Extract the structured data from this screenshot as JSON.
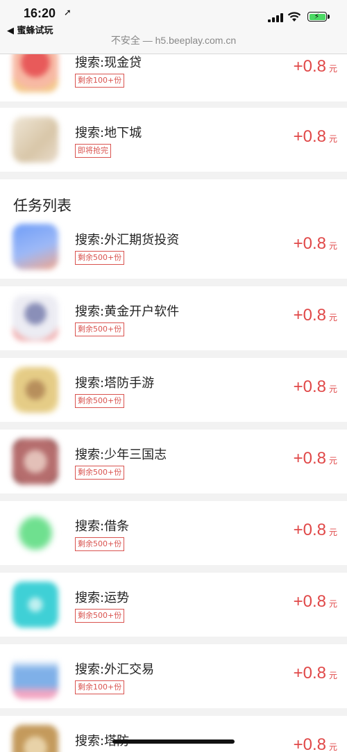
{
  "status": {
    "time": "16:20",
    "back_app": "◀ 蜜蜂试玩",
    "url": "不安全 — h5.beeplay.com.cn"
  },
  "section_title": "任务列表",
  "top_tasks": [
    {
      "title": "搜索:现金贷",
      "tag": "剩余100+份",
      "reward": "+0.8",
      "unit": "元",
      "icon_color": "#e85a5a"
    },
    {
      "title": "搜索:地下城",
      "tag": "即将抢完",
      "reward": "+0.8",
      "unit": "元",
      "icon_color": "#e8d9c0"
    }
  ],
  "tasks": [
    {
      "title": "搜索:外汇期货投资",
      "tag": "剩余500+份",
      "reward": "+0.8",
      "unit": "元",
      "icon_color": "#7aa6f5"
    },
    {
      "title": "搜索:黄金开户软件",
      "tag": "剩余500+份",
      "reward": "+0.8",
      "unit": "元",
      "icon_color": "#c9c9e0"
    },
    {
      "title": "搜索:塔防手游",
      "tag": "剩余500+份",
      "reward": "+0.8",
      "unit": "元",
      "icon_color": "#d8b86a"
    },
    {
      "title": "搜索:少年三国志",
      "tag": "剩余500+份",
      "reward": "+0.8",
      "unit": "元",
      "icon_color": "#c88080"
    },
    {
      "title": "搜索:借条",
      "tag": "剩余500+份",
      "reward": "+0.8",
      "unit": "元",
      "icon_color": "#6fe08f"
    },
    {
      "title": "搜索:运势",
      "tag": "剩余500+份",
      "reward": "+0.8",
      "unit": "元",
      "icon_color": "#4fd4d8"
    },
    {
      "title": "搜索:外汇交易",
      "tag": "剩余100+份",
      "reward": "+0.8",
      "unit": "元",
      "icon_color": "#7fb0e8"
    },
    {
      "title": "搜索:塔防",
      "tag": "",
      "reward": "+0.8",
      "unit": "元",
      "icon_color": "#c8a870"
    }
  ]
}
